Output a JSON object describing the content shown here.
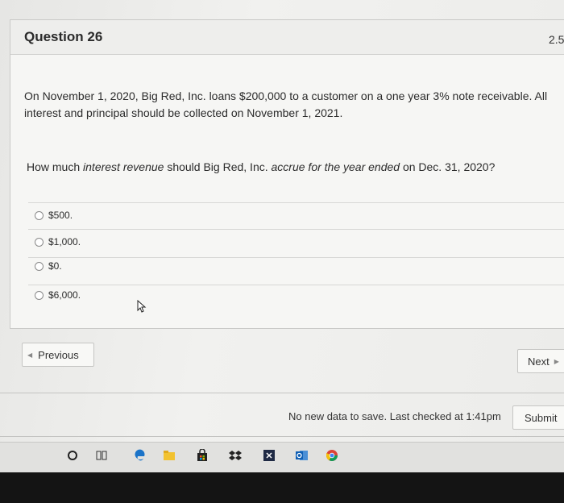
{
  "question": {
    "title": "Question 26",
    "points": "2.5",
    "stem": "On November 1, 2020, Big Red, Inc. loans $200,000 to a customer on a one year 3% note receivable. All interest and principal should be collected on November 1, 2021.",
    "ask_prefix": "How much ",
    "ask_italic_1": "interest revenue",
    "ask_middle": " should Big Red, Inc. ",
    "ask_italic_2": "accrue for the year ended",
    "ask_suffix": " on Dec. 31, 2020?",
    "options": [
      "$500.",
      "$1,000.",
      "$0.",
      "$6,000."
    ]
  },
  "nav": {
    "previous_label": "Previous",
    "next_label": "Next"
  },
  "footer": {
    "save_status": "No new data to save. Last checked at 1:41pm",
    "submit_label": "Submit"
  },
  "taskbar": {
    "icons": [
      "cortana-icon",
      "task-view-icon",
      "edge-icon",
      "file-explorer-icon",
      "store-icon",
      "dropbox-icon",
      "excel-icon",
      "outlook-icon",
      "chrome-icon"
    ]
  },
  "colors": {
    "page_bg": "#efefed",
    "card_bg": "#f6f6f4",
    "text": "#2b2b2b"
  }
}
